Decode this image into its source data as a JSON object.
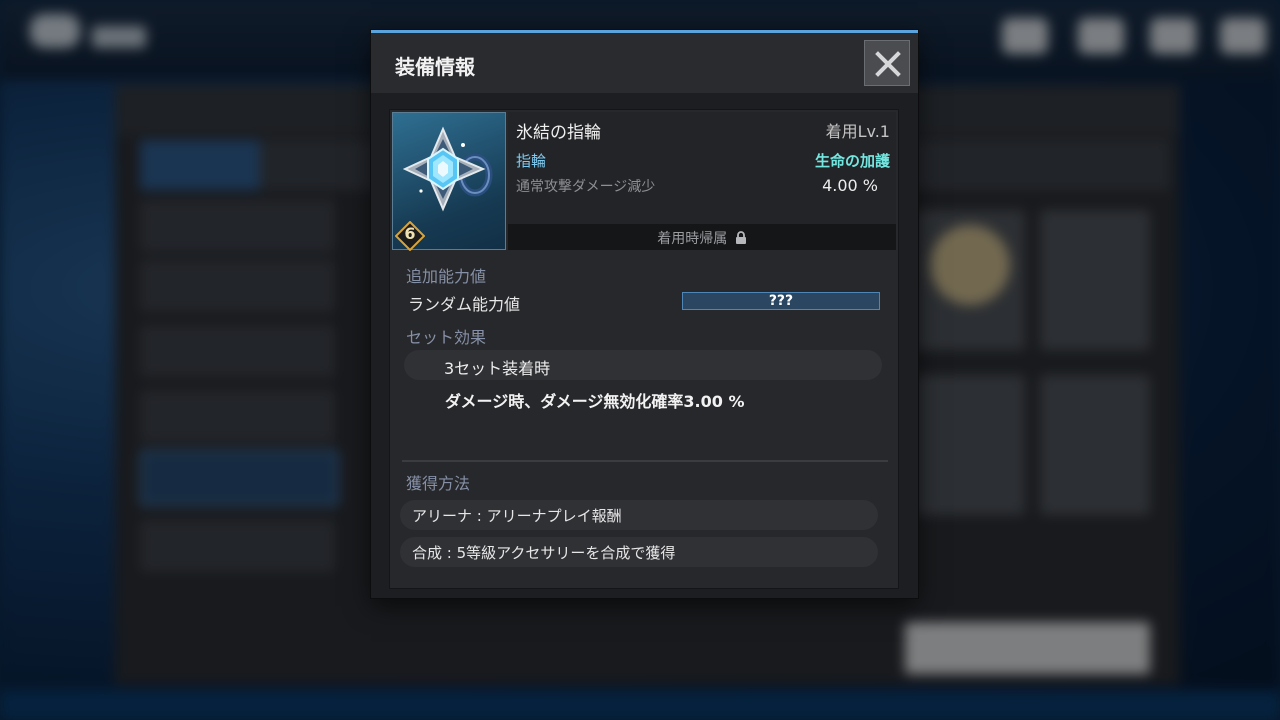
{
  "dialog": {
    "title": "装備情報",
    "close_icon": "close-icon"
  },
  "item": {
    "name": "氷結の指輪",
    "level_label": "着用Lv.1",
    "type": "指輪",
    "set_name": "生命の加護",
    "stat_label": "通常攻撃ダメージ減少",
    "stat_value": "4.00 %",
    "grade": "6",
    "bind_text": "着用時帰属",
    "icon": "frost-ring-icon"
  },
  "additional": {
    "section_label": "追加能力値",
    "random_label": "ランダム能力値",
    "random_value": "???"
  },
  "set_effect": {
    "section_label": "セット効果",
    "condition": "3セット装着時",
    "effect": "ダメージ時、ダメージ無効化確率3.00 %"
  },
  "acquisition": {
    "section_label": "獲得方法",
    "methods": [
      "アリーナ : アリーナプレイ報酬",
      "合成 : 5等級アクセサリーを合成で獲得"
    ]
  },
  "colors": {
    "accent": "#5aa3dd",
    "type_color": "#7ec9f0",
    "set_color": "#74e6e0"
  }
}
